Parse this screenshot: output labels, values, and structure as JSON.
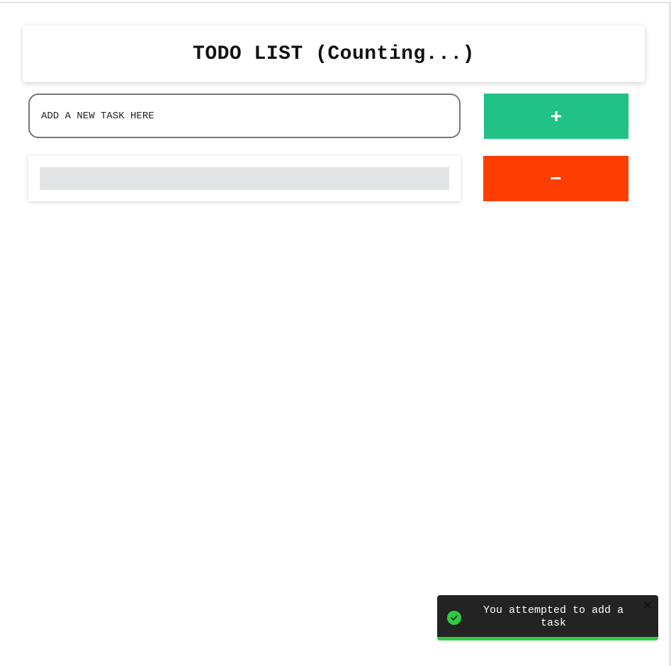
{
  "header": {
    "title": "TODO LIST (Counting...)"
  },
  "task_form": {
    "input_value": "",
    "input_placeholder": "ADD A NEW TASK HERE",
    "add_button_label": "+"
  },
  "task_list": {
    "items": [
      {
        "text": "",
        "remove_button_label": "−"
      }
    ]
  },
  "toast": {
    "message": "You attempted to add a task",
    "status": "success",
    "icon": "check-circle-icon",
    "close_icon": "close-icon",
    "progress": 1.0
  },
  "colors": {
    "add_button": "#20c285",
    "remove_button": "#ff3d00",
    "toast_background": "#232323",
    "toast_accent": "#2ecc40",
    "skeleton": "#e2e3e5"
  }
}
